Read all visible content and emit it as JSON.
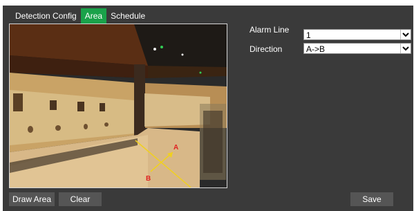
{
  "tabs": [
    {
      "label": "Detection Config"
    },
    {
      "label": "Area"
    },
    {
      "label": "Schedule"
    }
  ],
  "form": {
    "alarm_line_label": "Alarm Line",
    "alarm_line_value": "1",
    "direction_label": "Direction",
    "direction_value": "A->B"
  },
  "overlay": {
    "point_a": "A",
    "point_b": "B"
  },
  "buttons": {
    "draw_area": "Draw Area",
    "clear": "Clear",
    "save": "Save"
  },
  "colors": {
    "accent": "#1aa24a",
    "panel": "#3a3a3a",
    "line": "#f0d020",
    "marker": "#e02020"
  }
}
